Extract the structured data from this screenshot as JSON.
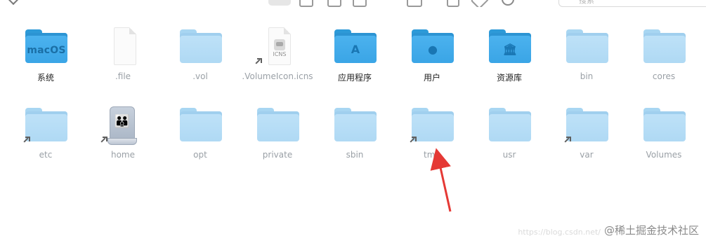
{
  "toolbar": {
    "search_placeholder": "搜索"
  },
  "items": [
    {
      "label": "系统",
      "dim": false,
      "kind": "folder-blue",
      "glyph": "macOS"
    },
    {
      "label": ".file",
      "dim": true,
      "kind": "document"
    },
    {
      "label": ".vol",
      "dim": true,
      "kind": "folder-light"
    },
    {
      "label": ".VolumeIcon.icns",
      "dim": true,
      "kind": "document-icns",
      "doc_caption": "ICNS",
      "alias": true
    },
    {
      "label": "应用程序",
      "dim": false,
      "kind": "folder-blue",
      "glyph": "A"
    },
    {
      "label": "用户",
      "dim": false,
      "kind": "folder-blue",
      "glyph": "●"
    },
    {
      "label": "资源库",
      "dim": false,
      "kind": "folder-blue",
      "glyph": "🏛"
    },
    {
      "label": "bin",
      "dim": true,
      "kind": "folder-light"
    },
    {
      "label": "cores",
      "dim": true,
      "kind": "folder-light"
    },
    {
      "label": "etc",
      "dim": true,
      "kind": "folder-light",
      "alias": true
    },
    {
      "label": "home",
      "dim": true,
      "kind": "drive",
      "alias": true
    },
    {
      "label": "opt",
      "dim": true,
      "kind": "folder-light"
    },
    {
      "label": "private",
      "dim": true,
      "kind": "folder-light"
    },
    {
      "label": "sbin",
      "dim": true,
      "kind": "folder-light"
    },
    {
      "label": "tmp",
      "dim": true,
      "kind": "folder-light",
      "alias": true
    },
    {
      "label": "usr",
      "dim": true,
      "kind": "folder-light"
    },
    {
      "label": "var",
      "dim": true,
      "kind": "folder-light",
      "alias": true
    },
    {
      "label": "Volumes",
      "dim": true,
      "kind": "folder-light"
    }
  ],
  "watermark": {
    "text": "@稀土掘金技术社区",
    "url": "https://blog.csdn.net/"
  },
  "colors": {
    "folder_blue": "#3aa5e6",
    "folder_light": "#b7ddf6",
    "annotation_red": "#e53935"
  }
}
